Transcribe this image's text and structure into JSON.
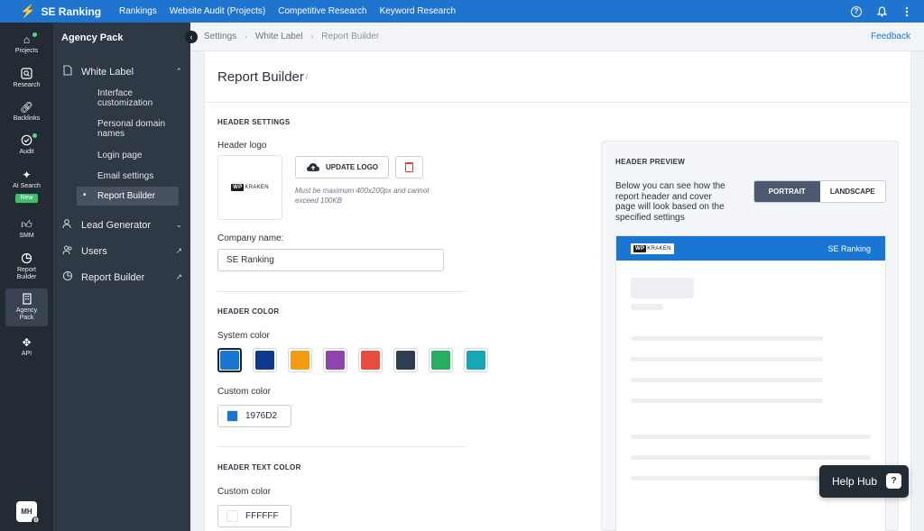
{
  "app": {
    "brand": "SE Ranking"
  },
  "topnav": [
    "Rankings",
    "Website Audit (Projects)",
    "Competitive Research",
    "Keyword Research"
  ],
  "rail": {
    "items": [
      {
        "label": "Projects"
      },
      {
        "label": "Research"
      },
      {
        "label": "Backlinks"
      },
      {
        "label": "Audit"
      },
      {
        "label": "AI Search",
        "badge": "New"
      },
      {
        "label": "SMM"
      },
      {
        "label": "Report Builder"
      },
      {
        "label": "Agency Pack"
      },
      {
        "label": "API"
      }
    ],
    "avatar": "MH"
  },
  "sidebar": {
    "title": "Agency Pack",
    "white_label": "White Label",
    "sub_items": [
      "Interface customization",
      "Personal domain names",
      "Login page",
      "Email settings",
      "Report Builder"
    ],
    "lead_generator": "Lead Generator",
    "users": "Users",
    "report_builder": "Report Builder"
  },
  "breadcrumb": {
    "items": [
      "Settings",
      "White Label",
      "Report Builder"
    ],
    "feedback": "Feedback"
  },
  "page": {
    "title": "Report Builder",
    "title_info": "i"
  },
  "header_settings": {
    "section_title": "HEADER SETTINGS",
    "logo_label": "Header logo",
    "logo_text_mark": "WP",
    "logo_text": "KRAKEN",
    "update_logo": "UPDATE LOGO",
    "hint": "Must be maximum 400x200px and cannot exceed 100KB",
    "company_label": "Company name:",
    "company_value": "SE Ranking"
  },
  "header_color": {
    "section_title": "HEADER COLOR",
    "system_label": "System color",
    "swatches": [
      "#1976d2",
      "#0d3a8c",
      "#f39c12",
      "#8e44ad",
      "#e74c3c",
      "#2c3e50",
      "#27ae60",
      "#16a6b6"
    ],
    "selected_index": 0,
    "custom_label": "Custom color",
    "custom_value": "1976D2",
    "custom_color": "#1976d2"
  },
  "header_text_color": {
    "section_title": "HEADER TEXT COLOR",
    "custom_label": "Custom color",
    "custom_value": "FFFFFF",
    "custom_color": "#ffffff"
  },
  "preview": {
    "title": "HEADER PREVIEW",
    "description": "Below you can see how the report header and cover page will look based on the specified settings",
    "modes": [
      "PORTRAIT",
      "LANDSCAPE"
    ],
    "active_mode": "PORTRAIT",
    "company": "SE Ranking"
  },
  "help_hub": {
    "label": "Help Hub"
  }
}
